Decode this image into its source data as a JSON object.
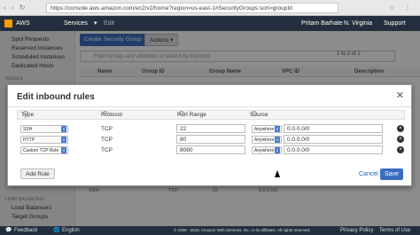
{
  "browser": {
    "secure": "Secure",
    "url": "https://console.aws.amazon.com/ec2/v2/home?region=us-east-1#SecurityGroups:sort=groupId"
  },
  "awsnav": {
    "brand": "AWS",
    "services": "Services",
    "edit": "Edit",
    "user": "Pritam Barhate",
    "region": "N. Virginia",
    "support": "Support"
  },
  "sidebar": {
    "items": [
      "Spot Requests",
      "Reserved Instances",
      "Scheduled Instances",
      "Dedicated Hosts"
    ],
    "images_head": "IMAGES",
    "lb_head": "LOAD BALANCING",
    "lb_items": [
      "Load Balancers",
      "Target Groups"
    ]
  },
  "toolbar": {
    "create": "Create Security Group",
    "actions": "Actions"
  },
  "filter": {
    "placeholder": "Filter by tags and attributes or search by keyword",
    "pager": "1 to 2 of 2"
  },
  "grid": {
    "columns": [
      "Name",
      "Group ID",
      "Group Name",
      "VPC ID",
      "Description"
    ]
  },
  "modal": {
    "title": "Edit inbound rules",
    "columns": [
      "Type",
      "Protocol",
      "Port Range",
      "Source"
    ],
    "rows": [
      {
        "type": "SSH",
        "protocol": "TCP",
        "port": "22",
        "source_mode": "Anywhere",
        "source": "0.0.0.0/0"
      },
      {
        "type": "HTTP",
        "protocol": "TCP",
        "port": "80",
        "source_mode": "Anywhere",
        "source": "0.0.0.0/0"
      },
      {
        "type": "Custom TCP Rule",
        "protocol": "TCP",
        "port": "8080",
        "source_mode": "Anywhere",
        "source": "0.0.0.0/0"
      }
    ],
    "add_rule": "Add Rule",
    "cancel": "Cancel",
    "save": "Save"
  },
  "lower": {
    "row_type": "SSH",
    "row_protocol": "TCP",
    "row_port": "22",
    "row_source": "0.0.0.0/0"
  },
  "footer": {
    "feedback": "Feedback",
    "language": "English",
    "copyright": "© 2008 - 2018, Amazon Web Services, Inc. or its affiliates. All rights reserved.",
    "privacy": "Privacy Policy",
    "terms": "Terms of Use"
  }
}
